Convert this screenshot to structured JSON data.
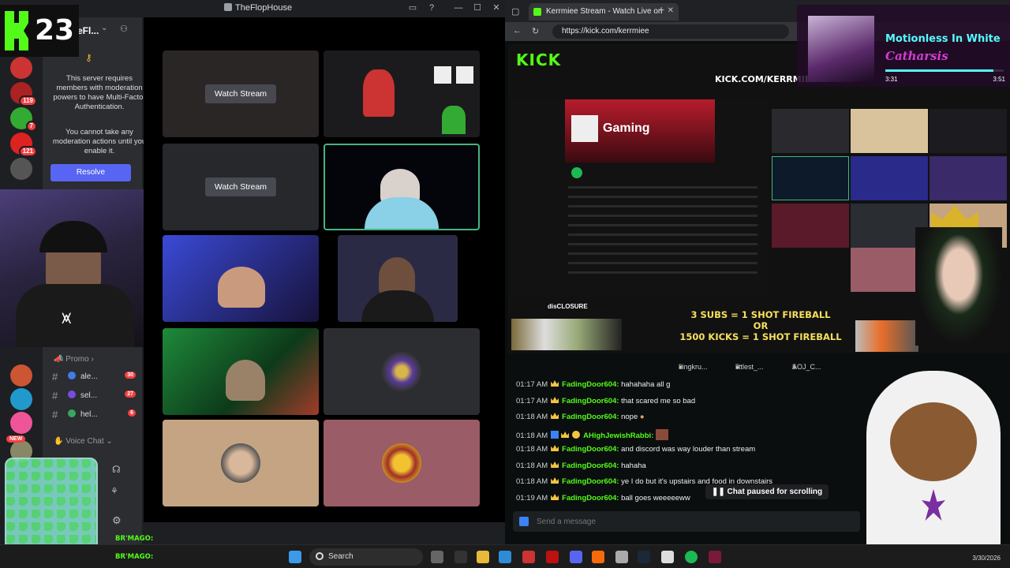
{
  "discord": {
    "window_title": "TheFlopHouse",
    "server_name": "eFl...",
    "overlay_count": "23",
    "mfa_notice_1": "This server requires members with moderation powers to have Multi-Factor Authentication.",
    "mfa_notice_2": "You cannot take any moderation actions until you enable it.",
    "resolve_label": "Resolve",
    "server_badges": [
      "119",
      "7",
      "121"
    ],
    "new_badge": "NEW",
    "categories": {
      "promo": "Promo",
      "voice": "Voice Chat"
    },
    "channels": [
      {
        "name": "ale...",
        "count": "30",
        "emoji_color": "#3f7de8"
      },
      {
        "name": "sel...",
        "count": "27",
        "emoji_color": "#7b4be0"
      },
      {
        "name": "hel...",
        "count": "6",
        "emoji_color": "#3ba55d"
      }
    ],
    "watch_stream_label": "Watch Stream",
    "name_tag": "BR'MAGO:"
  },
  "browser": {
    "tab_title": "Kerrmiee Stream - Watch Live on K",
    "url": "https://kick.com/kerrmiee",
    "kick_wordmark": "KICK",
    "kick_url_overlay": "KICK.COM/KERRMIEE",
    "spotify_title": "Gaming",
    "alert_user": "disCLOSURE",
    "overlay_goal_1": "3 SUBS = 1 SHOT FIREBALL",
    "overlay_goal_or": "OR",
    "overlay_goal_2": "1500 KICKS = 1 SHOT FIREBALL",
    "gifters": [
      {
        "name": "kingkru...",
        "count": "9"
      },
      {
        "name": "littlest_...",
        "count": "5"
      },
      {
        "name": "AOJ_C...",
        "count": "5"
      }
    ],
    "chat": [
      {
        "time": "01:17 AM",
        "user": "FadingDoor604",
        "text": "hahahaha all g"
      },
      {
        "time": "01:17 AM",
        "user": "FadingDoor604",
        "text": "that scared me so bad"
      },
      {
        "time": "01:18 AM",
        "user": "FadingDoor604",
        "text": "nope"
      },
      {
        "time": "01:18 AM",
        "user": "AHighJewishRabbi",
        "text": ""
      },
      {
        "time": "01:18 AM",
        "user": "FadingDoor604",
        "text": "and discord was way louder than stream"
      },
      {
        "time": "01:18 AM",
        "user": "FadingDoor604",
        "text": "hahaha"
      },
      {
        "time": "01:18 AM",
        "user": "FadingDoor604",
        "text": "ye I do but it's upstairs and food in downstairs"
      },
      {
        "time": "01:19 AM",
        "user": "FadingDoor604",
        "text": "ball goes weeeeeww"
      }
    ],
    "chat_paused": "Chat paused for scrolling",
    "send_placeholder": "Send a message"
  },
  "now_playing": {
    "title": "Motionless In White",
    "artist": "Catharsis",
    "elapsed": "3:31",
    "total": "3:51",
    "progress": 0.91
  },
  "taskbar": {
    "search_label": "Search",
    "date": "3/30/2026"
  },
  "colors": {
    "kick_green": "#53fc18",
    "discord_blurple": "#5865f2",
    "discord_bg": "#1e1f22",
    "alert_red": "#f23f43"
  }
}
